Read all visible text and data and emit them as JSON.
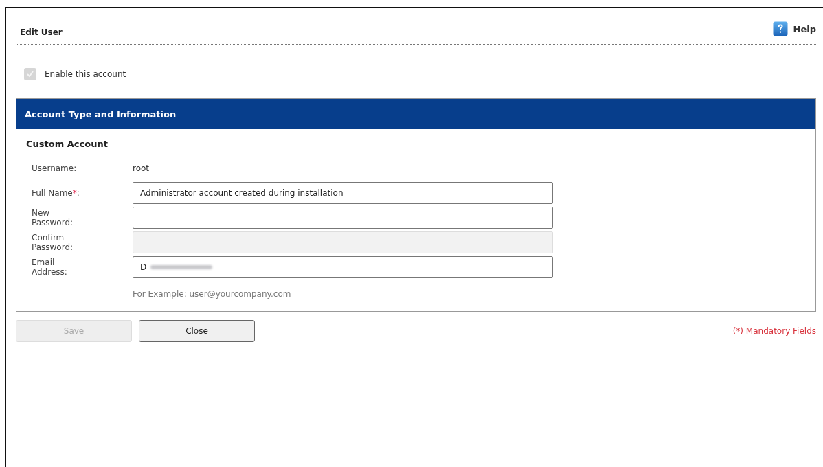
{
  "title": "Edit User",
  "help": {
    "label": "Help"
  },
  "enable_account": {
    "label": "Enable this account",
    "checked": true,
    "disabled": true
  },
  "panel": {
    "header": "Account Type and Information",
    "subtitle": "Custom Account",
    "fields": [
      {
        "kind": "static",
        "label": "Username:",
        "value": "root"
      },
      {
        "kind": "input",
        "label": "Full Name",
        "required_mark": "*",
        "label_end": ":",
        "value": "Administrator account created during installation",
        "disabled": false
      },
      {
        "kind": "input",
        "label": "New Password:",
        "disabled": false
      },
      {
        "kind": "input",
        "label": "Confirm Password:",
        "disabled": true
      },
      {
        "kind": "input",
        "label": "Email Address:",
        "value": "D",
        "redacted": true,
        "disabled": false
      }
    ],
    "hint": "For Example: user@yourcompany.com"
  },
  "buttons": [
    {
      "label": "Save",
      "disabled": true
    },
    {
      "label": "Close",
      "disabled": false
    }
  ],
  "mandatory_note": "(*) Mandatory Fields"
}
